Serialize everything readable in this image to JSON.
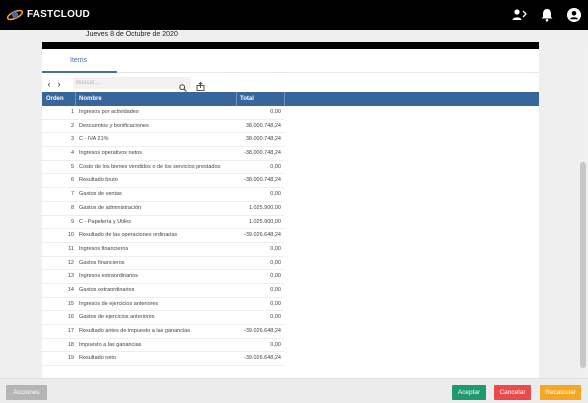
{
  "header": {
    "brand": "FASTCLOUD",
    "icons": [
      "user-switch-icon",
      "bell-icon",
      "account-icon"
    ]
  },
  "date": "Jueves 8 de Octubre de 2020",
  "tabs": [
    {
      "label": "Items"
    }
  ],
  "search": {
    "placeholder": "Buscar..."
  },
  "table": {
    "headers": {
      "orden": "Orden",
      "nombre": "Nombre",
      "total": "Total"
    },
    "rows": [
      {
        "orden": "1",
        "nombre": "Ingresos por actividades",
        "total": "0,00"
      },
      {
        "orden": "2",
        "nombre": "Descuentos y bonificaciones",
        "total": "38.000.748,24"
      },
      {
        "orden": "3",
        "nombre": "C - IVA 21%",
        "total": "38.000.748,24"
      },
      {
        "orden": "4",
        "nombre": "Ingresos operativos netos",
        "total": "-38.000.748,24"
      },
      {
        "orden": "5",
        "nombre": "Costo de los bienes vendidos o de los servicios prestados",
        "total": "0,00"
      },
      {
        "orden": "6",
        "nombre": "Resultado bruto",
        "total": "-38.000.748,24"
      },
      {
        "orden": "7",
        "nombre": "Gastos de ventas",
        "total": "0,00"
      },
      {
        "orden": "8",
        "nombre": "Gastos de administración",
        "total": "1.025.900,00"
      },
      {
        "orden": "9",
        "nombre": "C - Papelería y Utiles",
        "total": "1.025.900,00"
      },
      {
        "orden": "10",
        "nombre": "Resultado de las operaciones ordinarias",
        "total": "-39.026.648,24"
      },
      {
        "orden": "11",
        "nombre": "Ingresos financieros",
        "total": "0,00"
      },
      {
        "orden": "12",
        "nombre": "Gastos financieros",
        "total": "0,00"
      },
      {
        "orden": "13",
        "nombre": "Ingresos extraordinarios",
        "total": "0,00"
      },
      {
        "orden": "14",
        "nombre": "Gastos extraordinarios",
        "total": "0,00"
      },
      {
        "orden": "15",
        "nombre": "Ingresos de ejercicios anteriores",
        "total": "0,00"
      },
      {
        "orden": "16",
        "nombre": "Gastos de ejercicios anteriores",
        "total": "0,00"
      },
      {
        "orden": "17",
        "nombre": "Resultado antes de impuesto a las ganancias",
        "total": "-39.026.648,24"
      },
      {
        "orden": "18",
        "nombre": "Impuesto a las ganancias",
        "total": "0,00"
      },
      {
        "orden": "19",
        "nombre": "Resultado neto",
        "total": "-39.026.648,24"
      }
    ]
  },
  "footer": {
    "acciones": "Acciones",
    "aceptar": "Aceptar",
    "cancelar": "Cancelar",
    "recalcular": "Recalcular"
  },
  "colors": {
    "header_bg": "#000000",
    "table_header": "#37669a",
    "accent": "#4a6fa5",
    "aceptar": "#1e9a6e",
    "cancelar": "#e94a4a",
    "recalcular": "#f5a623",
    "acciones": "#b5b5b5"
  }
}
